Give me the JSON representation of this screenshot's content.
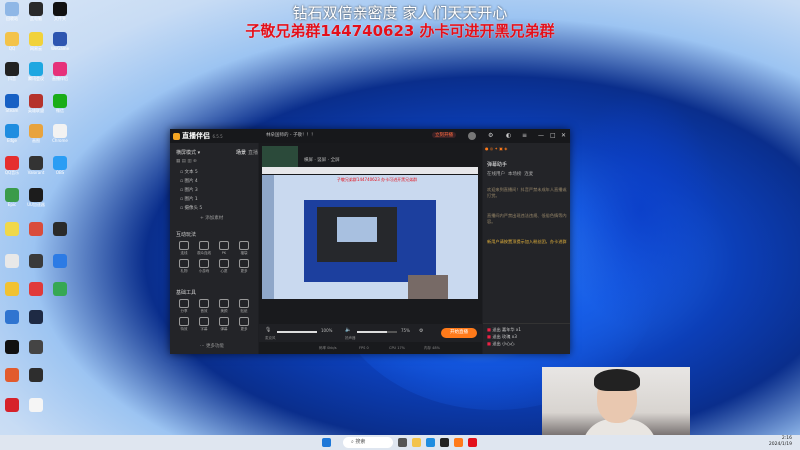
{
  "banner": {
    "line1": "钻石双倍亲密度 家人们天天开心",
    "line2": "子敬兄弟群144740623 办卡可进开黑兄弟群"
  },
  "colors": {
    "banner_red": "#e3101b",
    "accent_orange": "#ff7a1a"
  },
  "app": {
    "name": "直播伴侣",
    "version": "6.5.5",
    "stream_title": "林朵国师的 - 子敬！！！",
    "live_btn": "立刻开播",
    "close_icon": "close-icon"
  },
  "left": {
    "mode_label": "横屏模式",
    "tab_scene": "场景",
    "tab_source": "直播",
    "scene_items": [
      "文本 5",
      "图片 4",
      "图片 3",
      "图片 1",
      "摄像头 5"
    ],
    "add_source": "+ 添加素材",
    "interact_title": "互动玩法",
    "interact_tools": [
      "连线",
      "观众连线",
      "PK",
      "福袋",
      "礼物",
      "小游戏",
      "心愿",
      "更多"
    ],
    "basic_title": "基础工具",
    "basic_tools": [
      "分享",
      "音效",
      "美颜",
      "贴纸",
      "特效",
      "字幕",
      "弹幕",
      "更多"
    ],
    "more_link": "更多功能"
  },
  "center": {
    "toolbar_items": [
      "横屏",
      "竖屏",
      "全屏"
    ],
    "preview_notice": "子敬兄弟群144740623 办卡可进开黑兄弟群",
    "mic_label": "麦克风",
    "mic_pct": "100%",
    "speaker_label": "扬声器",
    "speaker_pct": "75%",
    "start_label": "开始直播",
    "status_items": [
      "码率 0kb/s",
      "FPS 0",
      "CPU 17%",
      "内存 48%"
    ]
  },
  "right": {
    "title": "弹幕助手",
    "tabs": [
      "在线用户",
      "本场榜",
      "连麦"
    ],
    "msgs": [
      "欢迎来到直播间！抖音严禁未成年人直播或打赏。",
      "直播间内严禁出现违法违规、低俗色情等内容。",
      "新用户请按置顶提示加入粉丝团，办卡进群"
    ],
    "gifts": [
      "送出 嘉年华 x1",
      "送出 玫瑰 x3",
      "送出 小心心"
    ]
  },
  "taskbar": {
    "search": "搜索",
    "time": "2:16",
    "date": "2024/1/19"
  },
  "desktop_icons": [
    "回收站",
    "此电脑",
    "文件夹",
    "QQ",
    "网易云",
    "WeGame",
    "抖音",
    "腾讯会议",
    "直播伴侣",
    "Steam",
    "英雄联盟",
    "微信",
    "Edge",
    "画图",
    "Chrome",
    "QQ音乐",
    "Valorant",
    "OBS",
    "Epic",
    "UU加速器"
  ]
}
